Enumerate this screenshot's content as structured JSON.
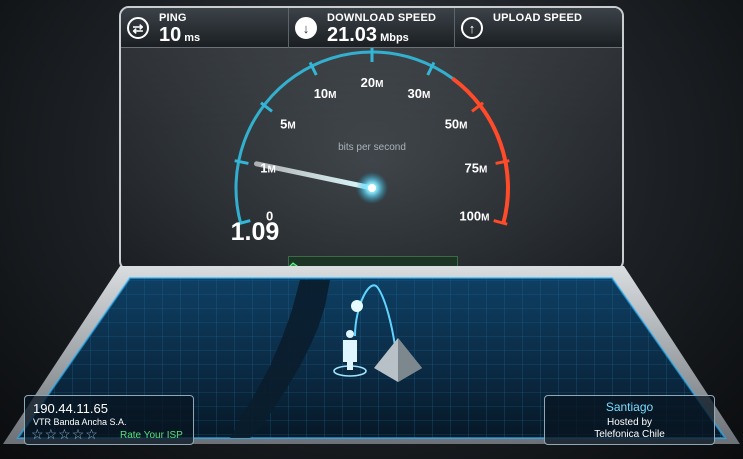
{
  "header": {
    "ping": {
      "label": "PING",
      "value": "10",
      "unit": "ms",
      "icon": "ping-arrows-icon"
    },
    "download": {
      "label": "DOWNLOAD SPEED",
      "value": "21.03",
      "unit": "Mbps",
      "icon": "download-arrow-icon"
    },
    "upload": {
      "label": "UPLOAD SPEED",
      "icon": "upload-arrow-icon"
    }
  },
  "gauge": {
    "unit_caption": "bits per second",
    "readout": "1.09",
    "needle_value_mbps": 1.09,
    "ticks": [
      {
        "num": "0",
        "suffix": ""
      },
      {
        "num": "1",
        "suffix": "M"
      },
      {
        "num": "5",
        "suffix": "M"
      },
      {
        "num": "10",
        "suffix": "M"
      },
      {
        "num": "20",
        "suffix": "M"
      },
      {
        "num": "30",
        "suffix": "M"
      },
      {
        "num": "50",
        "suffix": "M"
      },
      {
        "num": "75",
        "suffix": "M"
      },
      {
        "num": "100",
        "suffix": "M"
      }
    ],
    "colors": {
      "low": "#33b6d8",
      "high": "#ff4b2a",
      "needle": "#bff6ff"
    }
  },
  "isp": {
    "ip": "190.44.11.65",
    "name": "VTR Banda Ancha S.A.",
    "rate_label": "Rate Your ISP",
    "stars_total": 5,
    "stars_filled": 0
  },
  "server": {
    "city": "Santiago",
    "hosted_label": "Hosted by",
    "host": "Telefonica Chile"
  }
}
